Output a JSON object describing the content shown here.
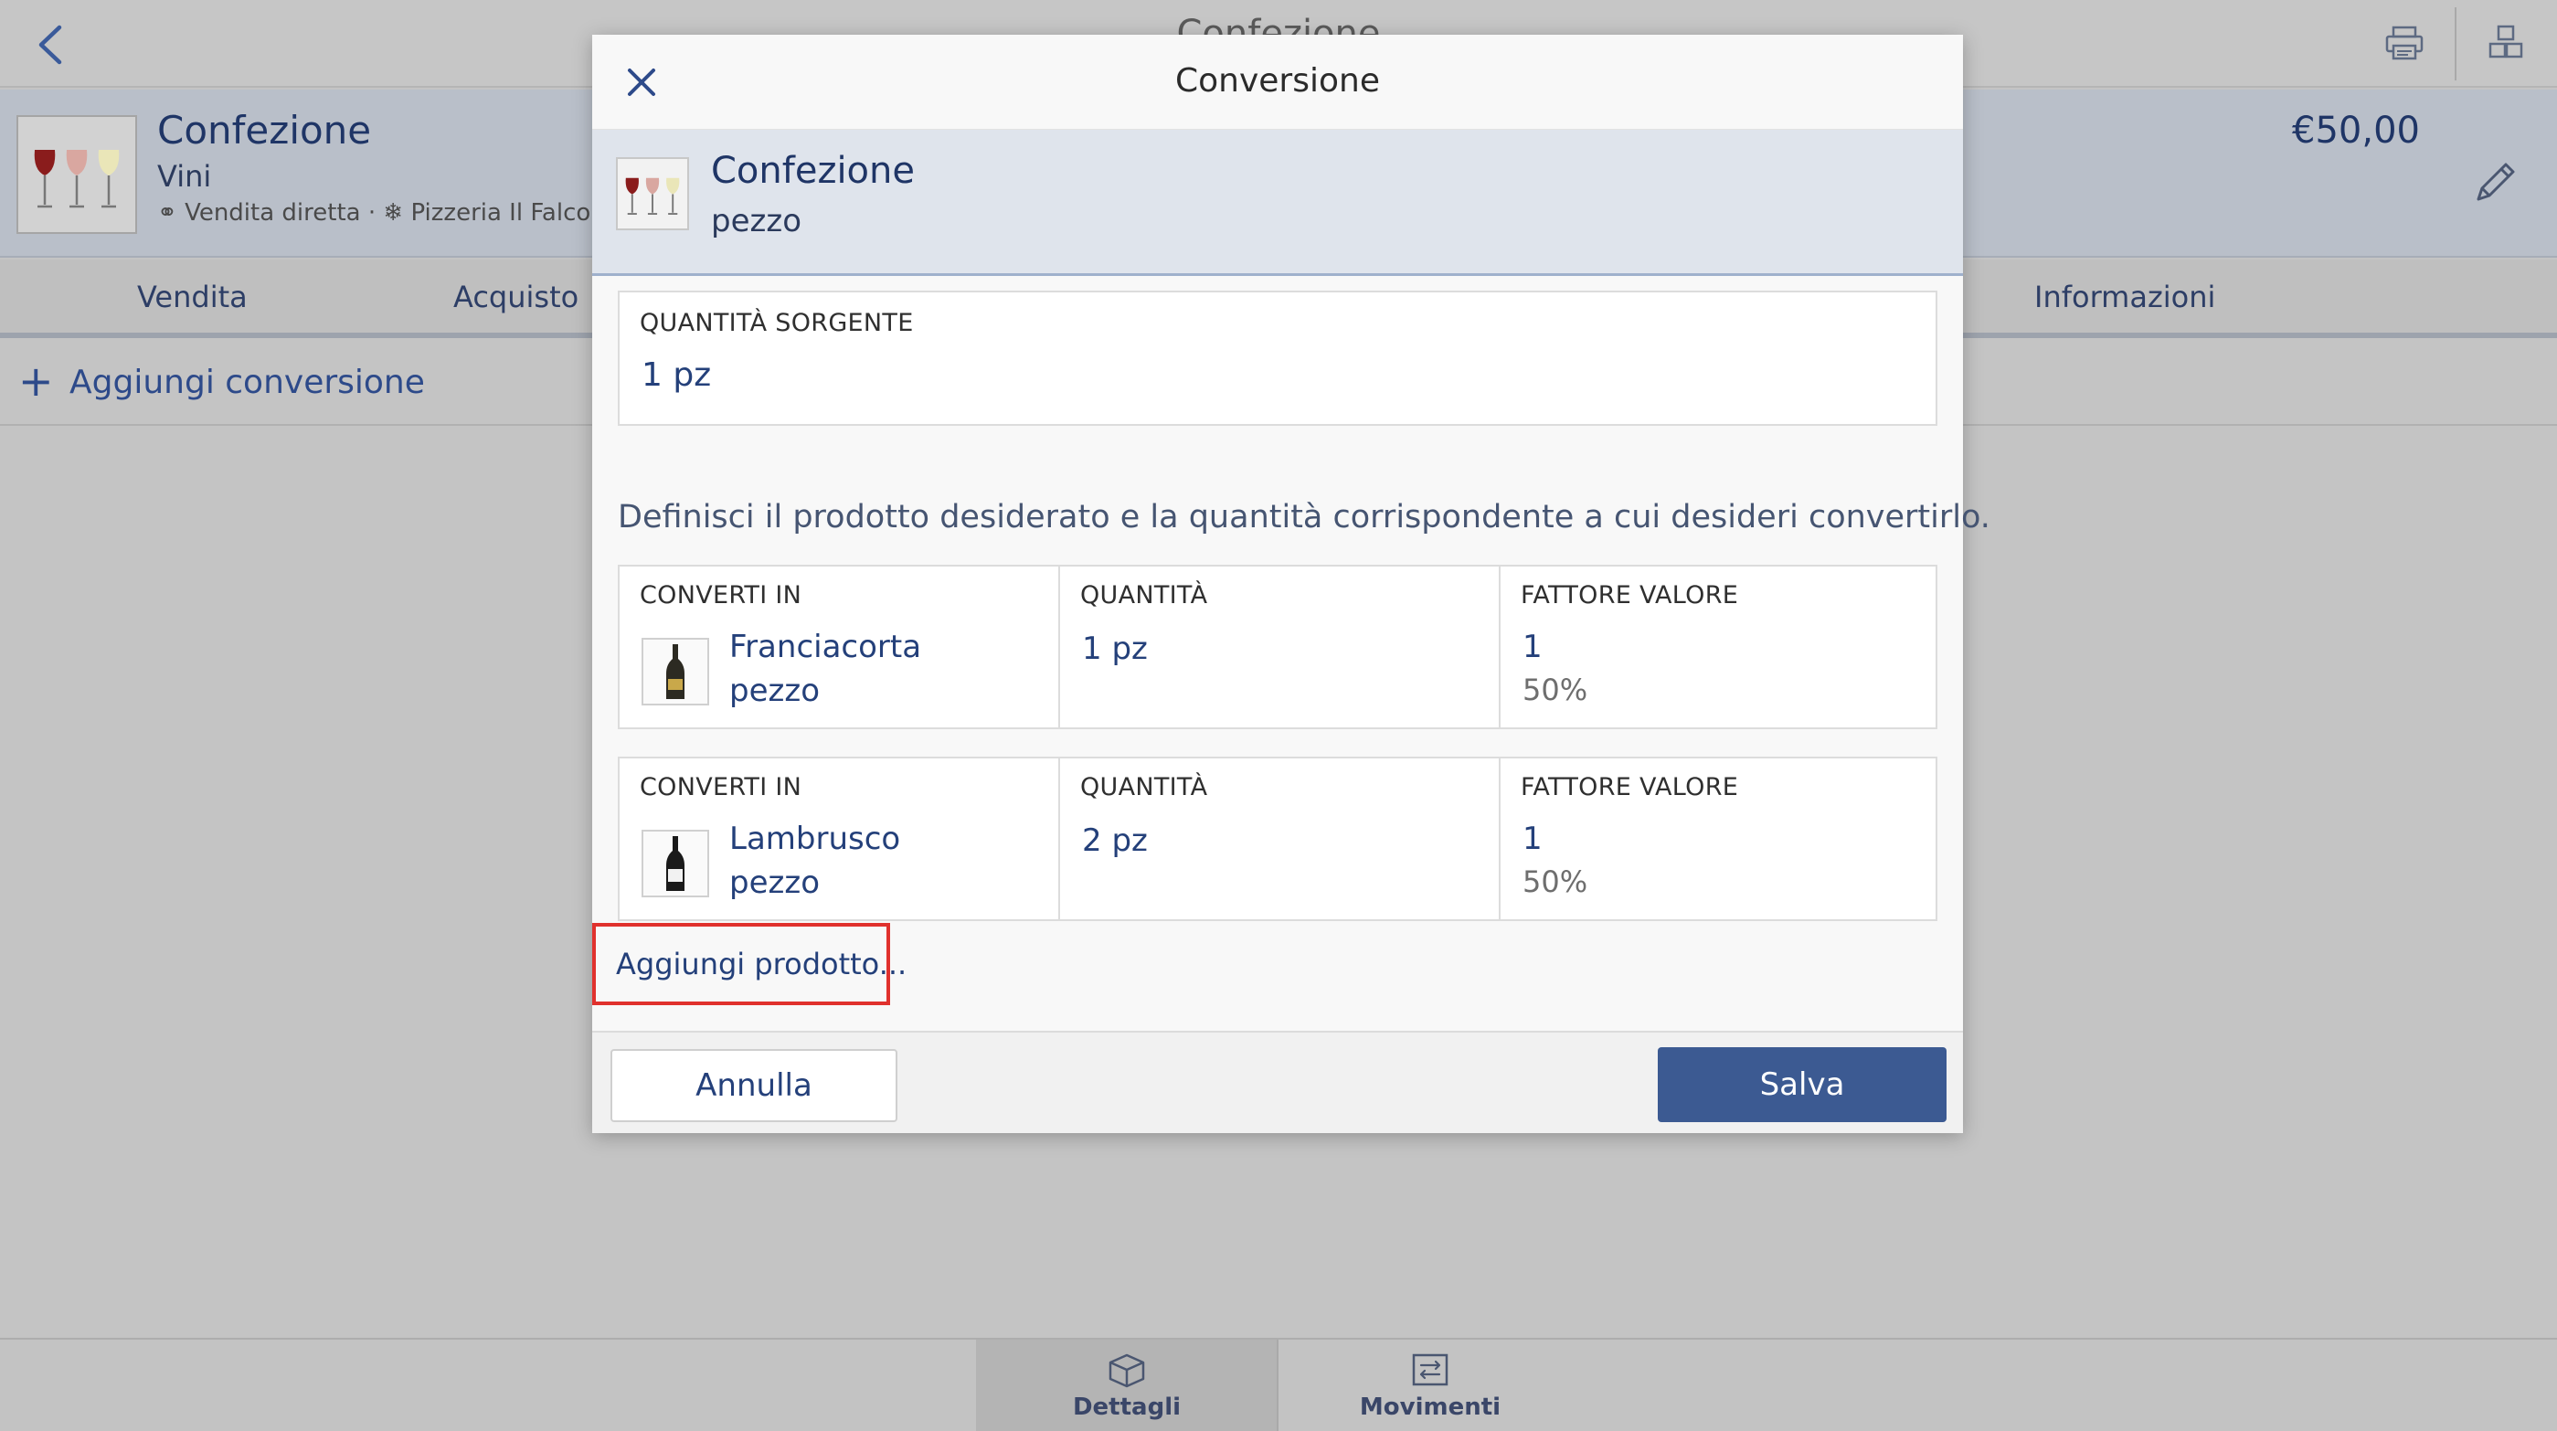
{
  "app": {
    "title": "Confezione"
  },
  "product": {
    "name": "Confezione",
    "category": "Vini",
    "channel": "Vendita diretta",
    "location": "Pizzeria Il Falconiere",
    "price": "€50,00"
  },
  "tabs": [
    {
      "label": "Vendita"
    },
    {
      "label": "Acquisto"
    },
    {
      "label": "Informazioni"
    }
  ],
  "add_conversion": {
    "plus": "+",
    "label": "Aggiungi conversione"
  },
  "modal": {
    "title": "Conversione",
    "product": {
      "name": "Confezione",
      "unit": "pezzo"
    },
    "source": {
      "label": "QUANTITÀ SORGENTE",
      "value": "1 pz"
    },
    "instruction": "Definisci il prodotto desiderato e la quantità corrispondente a cui desideri convertirlo.",
    "columns": {
      "convert_to": "CONVERTI IN",
      "quantity": "QUANTITÀ",
      "value_factor": "FATTORE VALORE"
    },
    "conversions": [
      {
        "product": "Franciacorta",
        "unit": "pezzo",
        "quantity": "1 pz",
        "factor": "1",
        "percent": "50%"
      },
      {
        "product": "Lambrusco",
        "unit": "pezzo",
        "quantity": "2 pz",
        "factor": "1",
        "percent": "50%"
      }
    ],
    "add_product": "Aggiungi prodotto...",
    "cancel_label": "Annulla",
    "save_label": "Salva"
  },
  "bottom_nav": [
    {
      "label": "Dettagli",
      "active": true
    },
    {
      "label": "Movimenti",
      "active": false
    }
  ],
  "colors": {
    "accent": "#3c5a92",
    "highlight": "#e0312d",
    "text_primary": "#24407a"
  },
  "icons": {
    "back": "chevron-left-icon",
    "printer": "printer-icon",
    "boxes": "boxes-icon",
    "edit": "pencil-icon",
    "close": "close-icon",
    "details": "package-icon",
    "movements": "transfer-icon"
  }
}
